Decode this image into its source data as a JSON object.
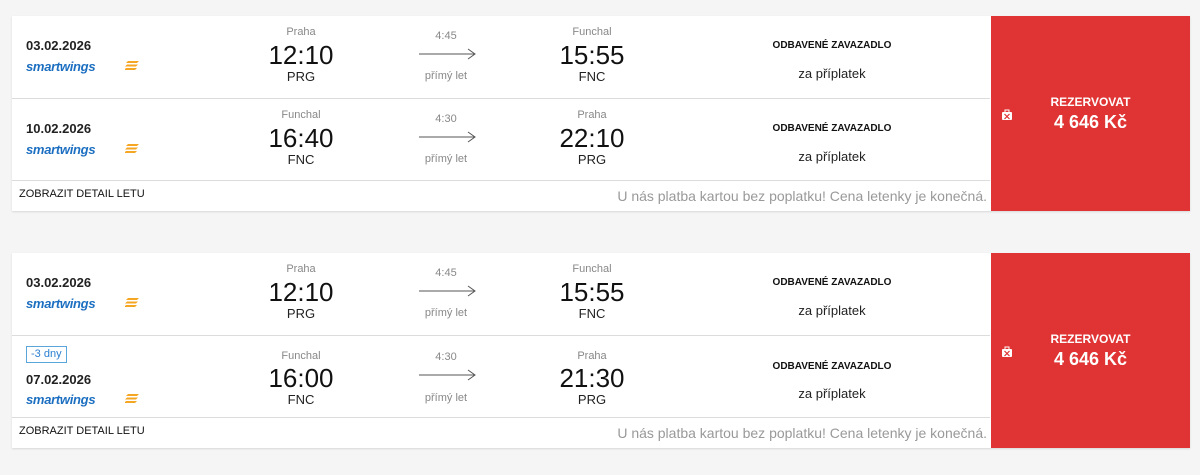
{
  "offers": [
    {
      "legs": [
        {
          "date": "03.02.2026",
          "airline": "smartwings",
          "dep_city": "Praha",
          "dep_time": "12:10",
          "dep_code": "PRG",
          "duration": "4:45",
          "direct": "přímý let",
          "arr_city": "Funchal",
          "arr_time": "15:55",
          "arr_code": "FNC",
          "bag_title": "ODBAVENÉ ZAVAZADLO",
          "bag_note": "za příplatek"
        },
        {
          "date": "10.02.2026",
          "airline": "smartwings",
          "dep_city": "Funchal",
          "dep_time": "16:40",
          "dep_code": "FNC",
          "duration": "4:30",
          "direct": "přímý let",
          "arr_city": "Praha",
          "arr_time": "22:10",
          "arr_code": "PRG",
          "bag_title": "ODBAVENÉ ZAVAZADLO",
          "bag_note": "za příplatek"
        }
      ],
      "detail_link": "ZOBRAZIT DETAIL LETU",
      "footer_note": "U nás platba kartou bez poplatku! Cena letenky je konečná.",
      "book_label": "REZERVOVAT",
      "price": "4 646 Kč"
    },
    {
      "legs": [
        {
          "date": "03.02.2026",
          "airline": "smartwings",
          "dep_city": "Praha",
          "dep_time": "12:10",
          "dep_code": "PRG",
          "duration": "4:45",
          "direct": "přímý let",
          "arr_city": "Funchal",
          "arr_time": "15:55",
          "arr_code": "FNC",
          "bag_title": "ODBAVENÉ ZAVAZADLO",
          "bag_note": "za příplatek"
        },
        {
          "days_badge": "-3 dny",
          "date": "07.02.2026",
          "airline": "smartwings",
          "dep_city": "Funchal",
          "dep_time": "16:00",
          "dep_code": "FNC",
          "duration": "4:30",
          "direct": "přímý let",
          "arr_city": "Praha",
          "arr_time": "21:30",
          "arr_code": "PRG",
          "bag_title": "ODBAVENÉ ZAVAZADLO",
          "bag_note": "za příplatek"
        }
      ],
      "detail_link": "ZOBRAZIT DETAIL LETU",
      "footer_note": "U nás platba kartou bez poplatku! Cena letenky je konečná.",
      "book_label": "REZERVOVAT",
      "price": "4 646 Kč"
    }
  ],
  "colors": {
    "accent_red": "#e03333",
    "airline_blue": "#1d6fc1",
    "logo_orange": "#f5a623",
    "badge_blue": "#5aa6da"
  },
  "icons": {
    "airline_logo": "smartwings-logo-icon",
    "arrow": "arrow-right-icon",
    "baggage": "baggage-icon"
  }
}
